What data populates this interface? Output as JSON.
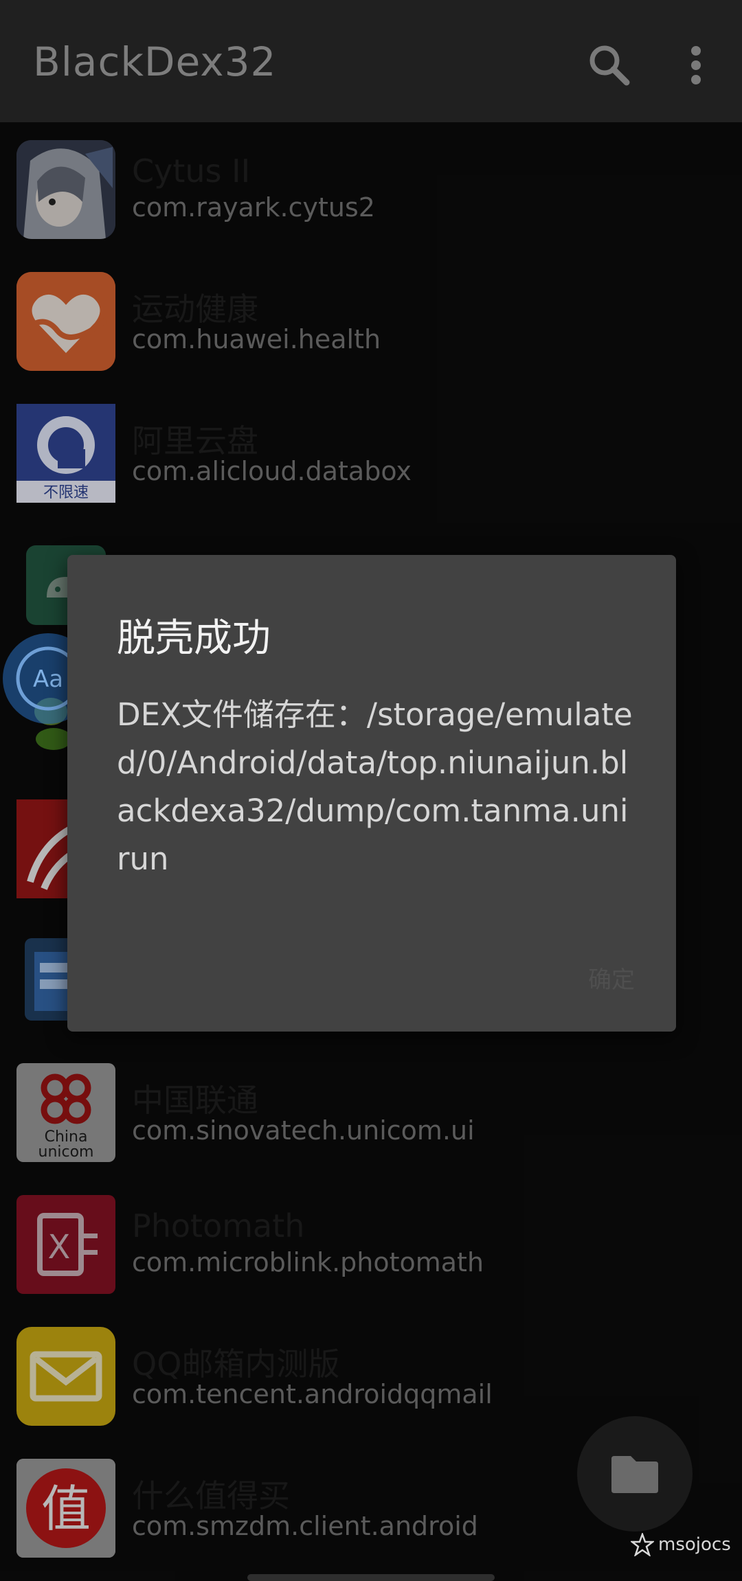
{
  "appbar": {
    "title": "BlackDex32",
    "search_icon": "search-icon",
    "menu_icon": "more-vert-icon"
  },
  "apps": [
    {
      "name": "Cytus II",
      "package": "com.rayark.cytus2",
      "icon": "cytus-icon"
    },
    {
      "name": "运动健康",
      "package": "com.huawei.health",
      "icon": "health-icon"
    },
    {
      "name": "阿里云盘",
      "package": "com.alicloud.databox",
      "icon": "aliyun-drive-icon"
    },
    {
      "name": "",
      "package": "",
      "icon": "android-icon"
    },
    {
      "name": "",
      "package": "",
      "icon": "wechat-icon"
    },
    {
      "name": "",
      "package": "",
      "icon": "red-app-icon"
    },
    {
      "name": "",
      "package": "",
      "icon": "file-manager-icon"
    },
    {
      "name": "中国联通",
      "package": "com.sinovatech.unicom.ui",
      "icon": "china-unicom-icon"
    },
    {
      "name": "Photomath",
      "package": "com.microblink.photomath",
      "icon": "photomath-icon"
    },
    {
      "name": "QQ邮箱内测版",
      "package": "com.tencent.androidqqmail",
      "icon": "qqmail-icon"
    },
    {
      "name": "什么值得买",
      "package": "com.smzdm.client.android",
      "icon": "smzdm-icon"
    }
  ],
  "dialog": {
    "title": "脱壳成功",
    "message": "DEX文件储存在：/storage/emulated/0/Android/data/top.niunaijun.blackdexa32/dump/com.tanma.unirun",
    "button": "确定"
  },
  "fab": {
    "icon": "folder-icon"
  },
  "watermark": {
    "text": "msojocs"
  },
  "colors": {
    "appbar": "#202020",
    "dialog": "#424242",
    "background": "#0a0a0a"
  }
}
